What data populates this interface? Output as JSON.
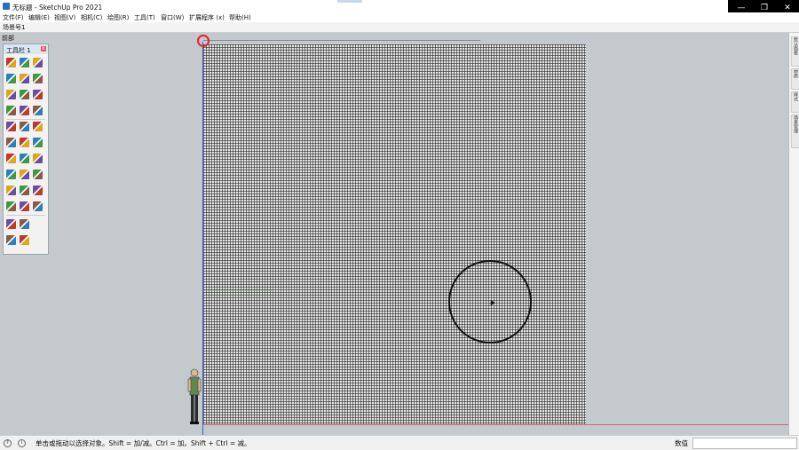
{
  "window": {
    "title": "无标题 - SketchUp Pro 2021",
    "controls": {
      "minimize": "—",
      "maximize": "❐",
      "close": "✕"
    }
  },
  "menu": {
    "items": [
      "文件(F)",
      "编辑(E)",
      "视图(V)",
      "相机(C)",
      "绘图(R)",
      "工具(T)",
      "窗口(W)",
      "扩展程序 (x)",
      "帮助(H)"
    ]
  },
  "scenes": {
    "label": "场景号1"
  },
  "viewport": {
    "perspective_label": "前部"
  },
  "toolbar": {
    "title": "工具栏 1",
    "close": "x",
    "icon_names": [
      [
        "select-icon",
        "eraser-icon",
        "paint-bucket-icon"
      ],
      [
        "lasso-icon",
        "rectangle-icon",
        "pencil-icon"
      ],
      [
        "arc-icon",
        "push-pull-icon",
        "offset-icon"
      ],
      [
        "line-icon",
        "follow-me-icon",
        "tape-measure-icon"
      ],
      [
        "orbit-icon",
        "pan-icon",
        "zoom-icon"
      ],
      [
        "walk-icon",
        "look-around-icon",
        "section-plane-icon"
      ],
      [
        "move-icon",
        "rotate-icon",
        "scale-icon"
      ],
      [
        "sandbox-from-contours-icon",
        "sandbox-smoove-icon",
        "sandbox-stamp-icon"
      ],
      [
        "component-icon",
        "group-icon",
        "solid-union-icon"
      ],
      [
        "solid-subtract-icon",
        "solid-intersect-icon",
        "solid-trim-icon"
      ],
      [
        "text-icon",
        "dimension-icon"
      ],
      [
        "import-icon",
        "export-icon"
      ]
    ]
  },
  "right_tray": {
    "tabs": [
      "默认面板",
      "材质",
      "样式",
      "场景管理"
    ]
  },
  "status": {
    "message": "单击或拖动以选择对象。Shift = 加/减。Ctrl = 加。Shift + Ctrl = 减。",
    "measurement_label": "数值",
    "measurement_value": ""
  },
  "colors": {
    "viewport_bg": "#c3c9cd",
    "axis_red": "#cc6666",
    "axis_blue": "#4a5bd6",
    "origin_marker": "#e0262c"
  }
}
